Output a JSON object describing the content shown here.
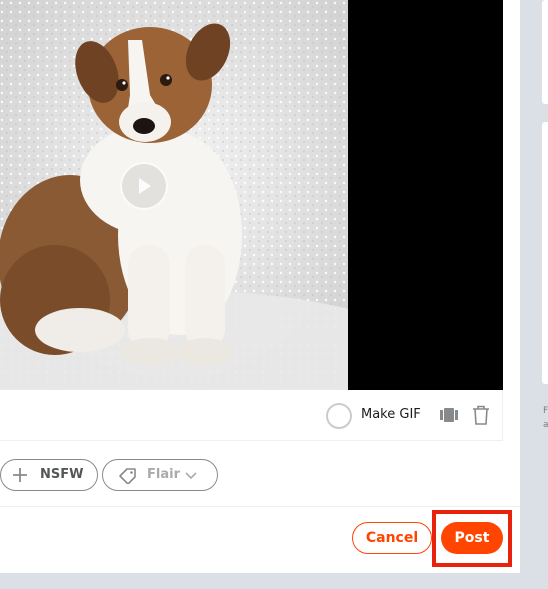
{
  "media": {
    "thumbnail_alt": "sheltie puppy sitting on white fluffy background"
  },
  "media_toolbar": {
    "gif_label": "Make GIF",
    "icons": [
      "thumbnail-icon",
      "trash-icon"
    ]
  },
  "tags": {
    "nsfw_label": "NSFW",
    "flair_label": "Flair"
  },
  "actions": {
    "cancel_label": "Cancel",
    "post_label": "Post"
  },
  "sidebar": {
    "snippet_line1": "F",
    "snippet_line2": "a"
  },
  "colors": {
    "accent": "#ff4500",
    "highlight": "#e8220b",
    "page_bg": "#dae0e6"
  }
}
